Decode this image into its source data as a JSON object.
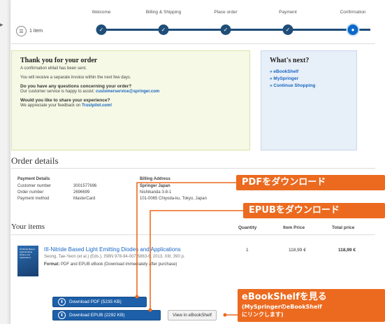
{
  "cart": {
    "count_label": "1 item"
  },
  "steps": [
    {
      "label": "Welcome"
    },
    {
      "label": "Billing & Shipping"
    },
    {
      "label": "Place order"
    },
    {
      "label": "Payment"
    },
    {
      "label": "Confirmation"
    }
  ],
  "thanks": {
    "title": "Thank you for your order",
    "line1": "A confirmation eMail has been sent.",
    "line2": "You will receive a separate invoice within the next few days.",
    "q_heading": "Do you have any questions concerning your order?",
    "q_text": "Our customer service is happy to assist:",
    "q_email": "customerservice@springer.com",
    "share_heading": "Would you like to share your experience?",
    "share_text": "We appreciate your feedback on",
    "share_link": "Trustpilot.com!"
  },
  "next": {
    "title": "What's next?",
    "links": [
      "» eBookShelf",
      "» MySpringer",
      "» Continue Shopping"
    ]
  },
  "order": {
    "heading": "Order details",
    "payment_title": "Payment Details",
    "rows": [
      {
        "k": "Customer number",
        "v": "3001577696"
      },
      {
        "k": "Order number",
        "v": "2696699"
      },
      {
        "k": "Payment method",
        "v": "MasterCard"
      }
    ],
    "billing_title": "Billing Address",
    "billing_name": "Springer Japan",
    "billing_line1": "Nishikanda 3-8-1",
    "billing_line2": "101-0065 Chiyoda-ku, Tokyo, Japan"
  },
  "items": {
    "heading": "Your items",
    "col_quantity": "Quantity",
    "col_item_price": "Item Price",
    "col_total_price": "Total price",
    "title": "III-Nitride Based Light Emitting Diodes and Applications",
    "meta": "Seong, Tae-Yeon (et al.) (Eds.), ISBN 978-94-007-5863-6, 2013, XIII, 390 p.",
    "format_label": "Format:",
    "format_text": "PDF and EPUB eBook (Download immediately after purchase)",
    "quantity": "1",
    "item_price": "118,99 €",
    "total_price": "118,99 €",
    "cover_text": "III-Nitride Based Light Emitting Diodes and Applications",
    "btn_pdf": "Download PDF (5235 KB)",
    "btn_epub": "Download EPUB (2292 KB)",
    "btn_shelf": "View in eBookShelf"
  },
  "callouts": {
    "pdf": "PDFをダウンロード",
    "epub": "EPUBをダウンロード",
    "shelf_title": "eBookShelfを見る",
    "shelf_sub1": "(MySpringerのeBookShelf",
    "shelf_sub2": "にリンクします)"
  },
  "colors": {
    "accent": "#ec6a1f",
    "brand_blue": "#1d5fa8",
    "link": "#1a66c2"
  }
}
